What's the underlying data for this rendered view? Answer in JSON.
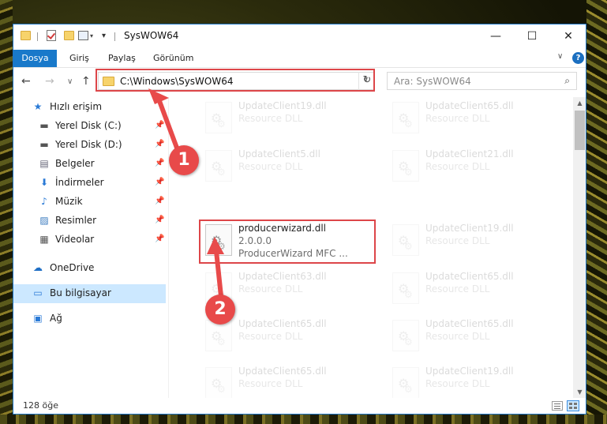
{
  "window": {
    "title": "SysWOW64",
    "controls": {
      "minimize": "—",
      "maximize": "☐",
      "close": "✕"
    }
  },
  "quick_access_toolbar": {
    "dropdown": "▾",
    "customize": "▾"
  },
  "ribbon": {
    "tabs": [
      "Dosya",
      "Giriş",
      "Paylaş",
      "Görünüm"
    ],
    "collapse_glyph": "∨",
    "help_glyph": "?"
  },
  "navigation": {
    "back": "←",
    "forward": "→",
    "recent": "∨",
    "up": "↑",
    "address": "C:\\Windows\\SysWOW64",
    "address_dropdown": "∨",
    "refresh": "↻",
    "search_placeholder": "Ara: SysWOW64",
    "search_glyph": "⌕"
  },
  "sidebar": {
    "items": [
      {
        "label": "Hızlı erişim",
        "icon": "star-icon",
        "glyph": "★",
        "pinned": false
      },
      {
        "label": "Yerel Disk (C:)",
        "icon": "drive-icon",
        "glyph": "▬",
        "pinned": true
      },
      {
        "label": "Yerel Disk (D:)",
        "icon": "drive-icon",
        "glyph": "▬",
        "pinned": true
      },
      {
        "label": "Belgeler",
        "icon": "documents-icon",
        "glyph": "▤",
        "pinned": true
      },
      {
        "label": "İndirmeler",
        "icon": "download-icon",
        "glyph": "⬇",
        "pinned": true
      },
      {
        "label": "Müzik",
        "icon": "music-icon",
        "glyph": "♪",
        "pinned": true
      },
      {
        "label": "Resimler",
        "icon": "pictures-icon",
        "glyph": "▨",
        "pinned": true
      },
      {
        "label": "Videolar",
        "icon": "videos-icon",
        "glyph": "▦",
        "pinned": true
      },
      {
        "label": "OneDrive",
        "icon": "cloud-icon",
        "glyph": "☁",
        "pinned": false
      },
      {
        "label": "Bu bilgisayar",
        "icon": "computer-icon",
        "glyph": "▭",
        "pinned": false,
        "selected": true
      },
      {
        "label": "Ağ",
        "icon": "network-icon",
        "glyph": "▣",
        "pinned": false
      }
    ],
    "pin_glyph": "📌"
  },
  "files": [
    {
      "name": "UpdateClient19.dll",
      "line2": "Resource DLL",
      "line3": "",
      "faded": true
    },
    {
      "name": "UpdateClient65.dll",
      "line2": "Resource DLL",
      "line3": "",
      "faded": true
    },
    {
      "name": "UpdateClient5.dll",
      "line2": "Resource DLL",
      "line3": "",
      "faded": true
    },
    {
      "name": "UpdateClient21.dll",
      "line2": "Resource DLL",
      "line3": "",
      "faded": true
    },
    {
      "name": "producerwizard.dll",
      "line2": "2.0.0.0",
      "line3": "ProducerWizard MFC ...",
      "faded": false
    },
    {
      "name": "UpdateClient19.dll",
      "line2": "Resource DLL",
      "line3": "",
      "faded": true
    },
    {
      "name": "UpdateClient63.dll",
      "line2": "Resource DLL",
      "line3": "",
      "faded": true
    },
    {
      "name": "UpdateClient65.dll",
      "line2": "Resource DLL",
      "line3": "",
      "faded": true
    },
    {
      "name": "UpdateClient65.dll",
      "line2": "Resource DLL",
      "line3": "",
      "faded": true
    },
    {
      "name": "UpdateClient65.dll",
      "line2": "Resource DLL",
      "line3": "",
      "faded": true
    },
    {
      "name": "UpdateClient65.dll",
      "line2": "Resource DLL",
      "line3": "",
      "faded": true
    },
    {
      "name": "UpdateClient19.dll",
      "line2": "Resource DLL",
      "line3": "",
      "faded": true
    }
  ],
  "scrollbar": {
    "up": "▲",
    "down": "▼"
  },
  "status": {
    "count": "128 öğe"
  },
  "annotations": {
    "step1": "1",
    "step2": "2",
    "highlight_color": "#dd4649",
    "badge_color": "#e84a4a"
  },
  "colors": {
    "accent": "#1979ca",
    "selection": "#cce8ff"
  }
}
